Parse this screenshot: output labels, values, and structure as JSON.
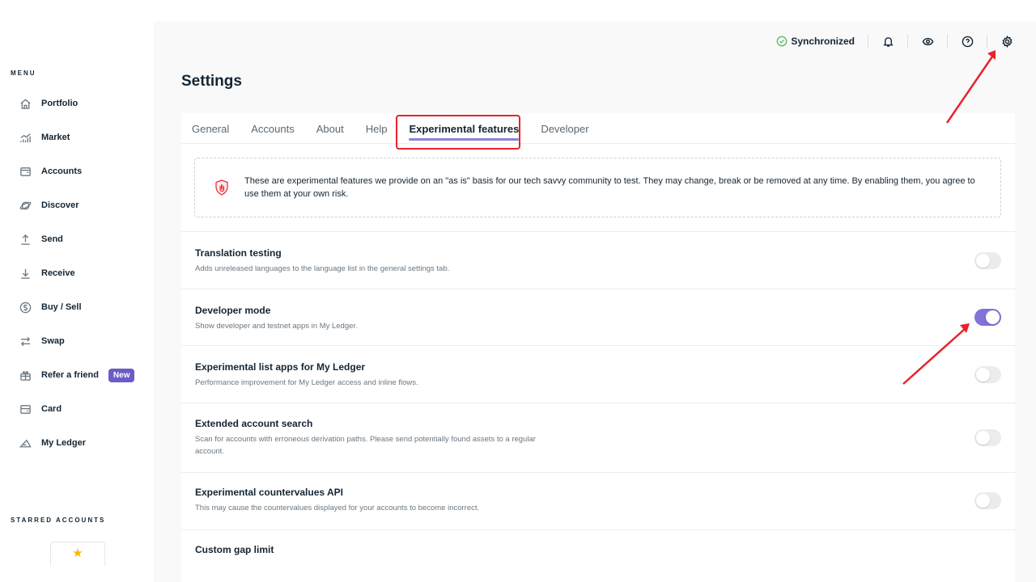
{
  "sidebar": {
    "menu_label": "MENU",
    "items": [
      {
        "label": "Portfolio",
        "icon": "home-icon"
      },
      {
        "label": "Market",
        "icon": "market-icon"
      },
      {
        "label": "Accounts",
        "icon": "wallet-icon"
      },
      {
        "label": "Discover",
        "icon": "planet-icon"
      },
      {
        "label": "Send",
        "icon": "send-icon"
      },
      {
        "label": "Receive",
        "icon": "receive-icon"
      },
      {
        "label": "Buy / Sell",
        "icon": "dollar-icon"
      },
      {
        "label": "Swap",
        "icon": "swap-icon"
      },
      {
        "label": "Refer a friend",
        "icon": "gift-icon",
        "badge": "New"
      },
      {
        "label": "Card",
        "icon": "card-icon"
      },
      {
        "label": "My Ledger",
        "icon": "ledger-icon"
      }
    ],
    "starred_label": "STARRED ACCOUNTS"
  },
  "topbar": {
    "sync_status": "Synchronized",
    "sync_color": "#5dbb63"
  },
  "page": {
    "title": "Settings"
  },
  "tabs": [
    {
      "label": "General"
    },
    {
      "label": "Accounts"
    },
    {
      "label": "About"
    },
    {
      "label": "Help"
    },
    {
      "label": "Experimental features",
      "active": true
    },
    {
      "label": "Developer"
    }
  ],
  "notice": {
    "text": "These are experimental features we provide on an \"as is\" basis for our tech savvy community to test. They may change, break or be removed at any time. By enabling them, you agree to use them at your own risk."
  },
  "settings": [
    {
      "title": "Translation testing",
      "desc": "Adds unreleased languages to the language list in the general settings tab.",
      "enabled": false
    },
    {
      "title": "Developer mode",
      "desc": "Show developer and testnet apps in My Ledger.",
      "enabled": true
    },
    {
      "title": "Experimental list apps for My Ledger",
      "desc": "Performance improvement for My Ledger access and inline flows.",
      "enabled": false
    },
    {
      "title": "Extended account search",
      "desc": "Scan for accounts with erroneous derivation paths. Please send potentially found assets to a regular account.",
      "enabled": false
    },
    {
      "title": "Experimental countervalues API",
      "desc": "This may cause the countervalues displayed for your accounts to become incorrect.",
      "enabled": false
    },
    {
      "title": "Custom gap limit",
      "desc": ""
    }
  ],
  "colors": {
    "accent": "#7f73d6",
    "highlight": "#e8232b",
    "badge": "#6a5bc7"
  }
}
